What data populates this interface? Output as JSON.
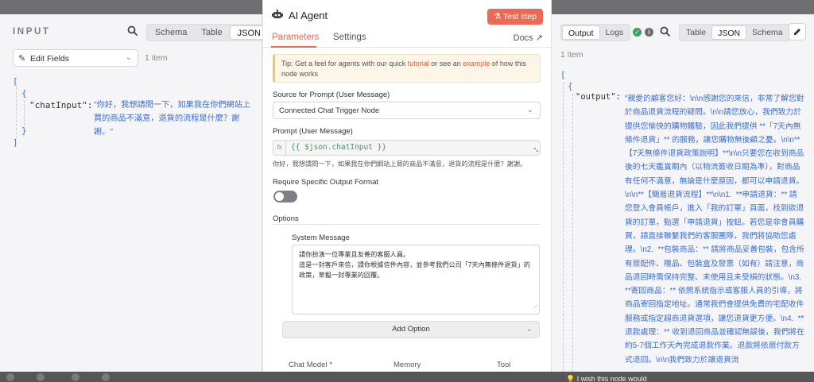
{
  "input_panel": {
    "title": "INPUT",
    "view_modes": [
      "Schema",
      "Table",
      "JSON"
    ],
    "active_view": "JSON",
    "node_select": "Edit Fields",
    "item_count": "1 item",
    "json": {
      "open_array": "[",
      "open_obj": "{",
      "key": "\"chatInput\":",
      "value": "\"你好，我想請問一下，如果我在你們網站上買的商品不滿意，退貨的流程是什麼？謝謝。\"",
      "close_obj": "}",
      "close_array": "]"
    }
  },
  "modal": {
    "title": "AI Agent",
    "test_button": "Test step",
    "tabs": [
      "Parameters",
      "Settings"
    ],
    "docs_link": "Docs",
    "tip": {
      "prefix": "Tip: Get a feel for agents with our quick ",
      "link1": "tutorial",
      "middle": " or see an ",
      "link2": "example",
      "suffix": " of how this node works"
    },
    "source_label": "Source for Prompt (User Message)",
    "source_value": "Connected Chat Trigger Node",
    "prompt_label": "Prompt (User Message)",
    "prompt_expression": "{{ $json.chatInput }}",
    "prompt_preview": "你好，我想請問一下，如果我在你們網站上買的商品不滿意，退貨的流程是什麼？謝謝。",
    "output_format_label": "Require Specific Output Format",
    "output_format_enabled": false,
    "options_label": "Options",
    "system_message_label": "System Message",
    "system_message": "請你扮演一位專業且友善的客服人員。\n這是一封客戶來信，請你根據信件內容，並參考我們公司「7天內無條件退貨」的政策，草擬一封專業的回覆。",
    "add_option": "Add Option",
    "sub_nodes": [
      "Chat Model *",
      "Memory",
      "Tool"
    ]
  },
  "output_panel": {
    "view_modes": [
      "Output",
      "Logs"
    ],
    "active_mode": "Output",
    "data_views": [
      "Table",
      "JSON",
      "Schema"
    ],
    "active_data_view": "JSON",
    "item_count": "1 item",
    "json": {
      "open_array": "[",
      "open_obj": "{",
      "key": "\"output\":",
      "value": "\"親愛的顧客您好：\\n\\n感謝您的來信，非常了解您對於商品退貨流程的疑問。\\n\\n請您放心，我們致力於提供您愉快的購物體驗，因此我們提供 **「7天內無條件退貨」** 的服務，讓您購物無後顧之憂。\\n\\n**【7天無條件退貨政策說明】**\\n\\n只要您在收到商品後的七天鑑賞期內（以物流簽收日期為準），對商品有任何不滿意，無論是什麼原因，都可以申請退貨。\\n\\n**【簡易退貨流程】**\\n\\n1.  **申請退貨：** 請您登入會員帳戶，進入「我的訂單」頁面，找到欲退貨的訂單，點選「申請退貨」按鈕。若您是非會員購買，請直接聯繫我們的客服團隊，我們將協助您處理。\\n2.  **包裝商品：** 請將商品妥善包裝，包含所有原配件、贈品、包裝盒及發票（如有）請注意，商品退回時需保持完整、未使用且未受損的狀態。\\n3.  **寄回商品：** 依照系統指示或客服人員的引導，將商品寄回指定地址。通常我們會提供免費的宅配收件服務或指定超商退貨選項，讓您退貨更方便。\\n4.  **退款處理：** 收到退回商品並確認無誤後，我們將在約5-7個工作天內完成退款作業。退款將依原付款方式退回。\\n\\n我們致力於讓退貨流"
    }
  },
  "footer": {
    "wish_text": "I wish this node would"
  },
  "colors": {
    "accent": "#ea6a50",
    "json_string": "#3a6fcf",
    "success": "#3aa15a"
  }
}
